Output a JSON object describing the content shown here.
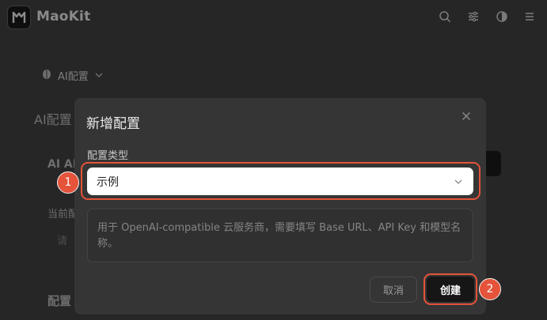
{
  "app": {
    "title": "MaoKit",
    "icons": [
      "search-icon",
      "sliders-icon",
      "theme-toggle-icon",
      "menu-icon"
    ]
  },
  "background": {
    "selector_label": "AI配置",
    "heading": "AI配置",
    "subheading": "AI AI",
    "current_label": "当前配",
    "input_hint": "请",
    "config_label": "配置"
  },
  "modal": {
    "title": "新增配置",
    "field_label": "配置类型",
    "select_value": "示例",
    "description": "用于 OpenAI-compatible 云服务商，需要填写 Base URL、API Key 和模型名称。",
    "cancel_label": "取消",
    "create_label": "创建"
  },
  "annotations": {
    "step1": "1",
    "step2": "2",
    "color": "#e4533a"
  }
}
